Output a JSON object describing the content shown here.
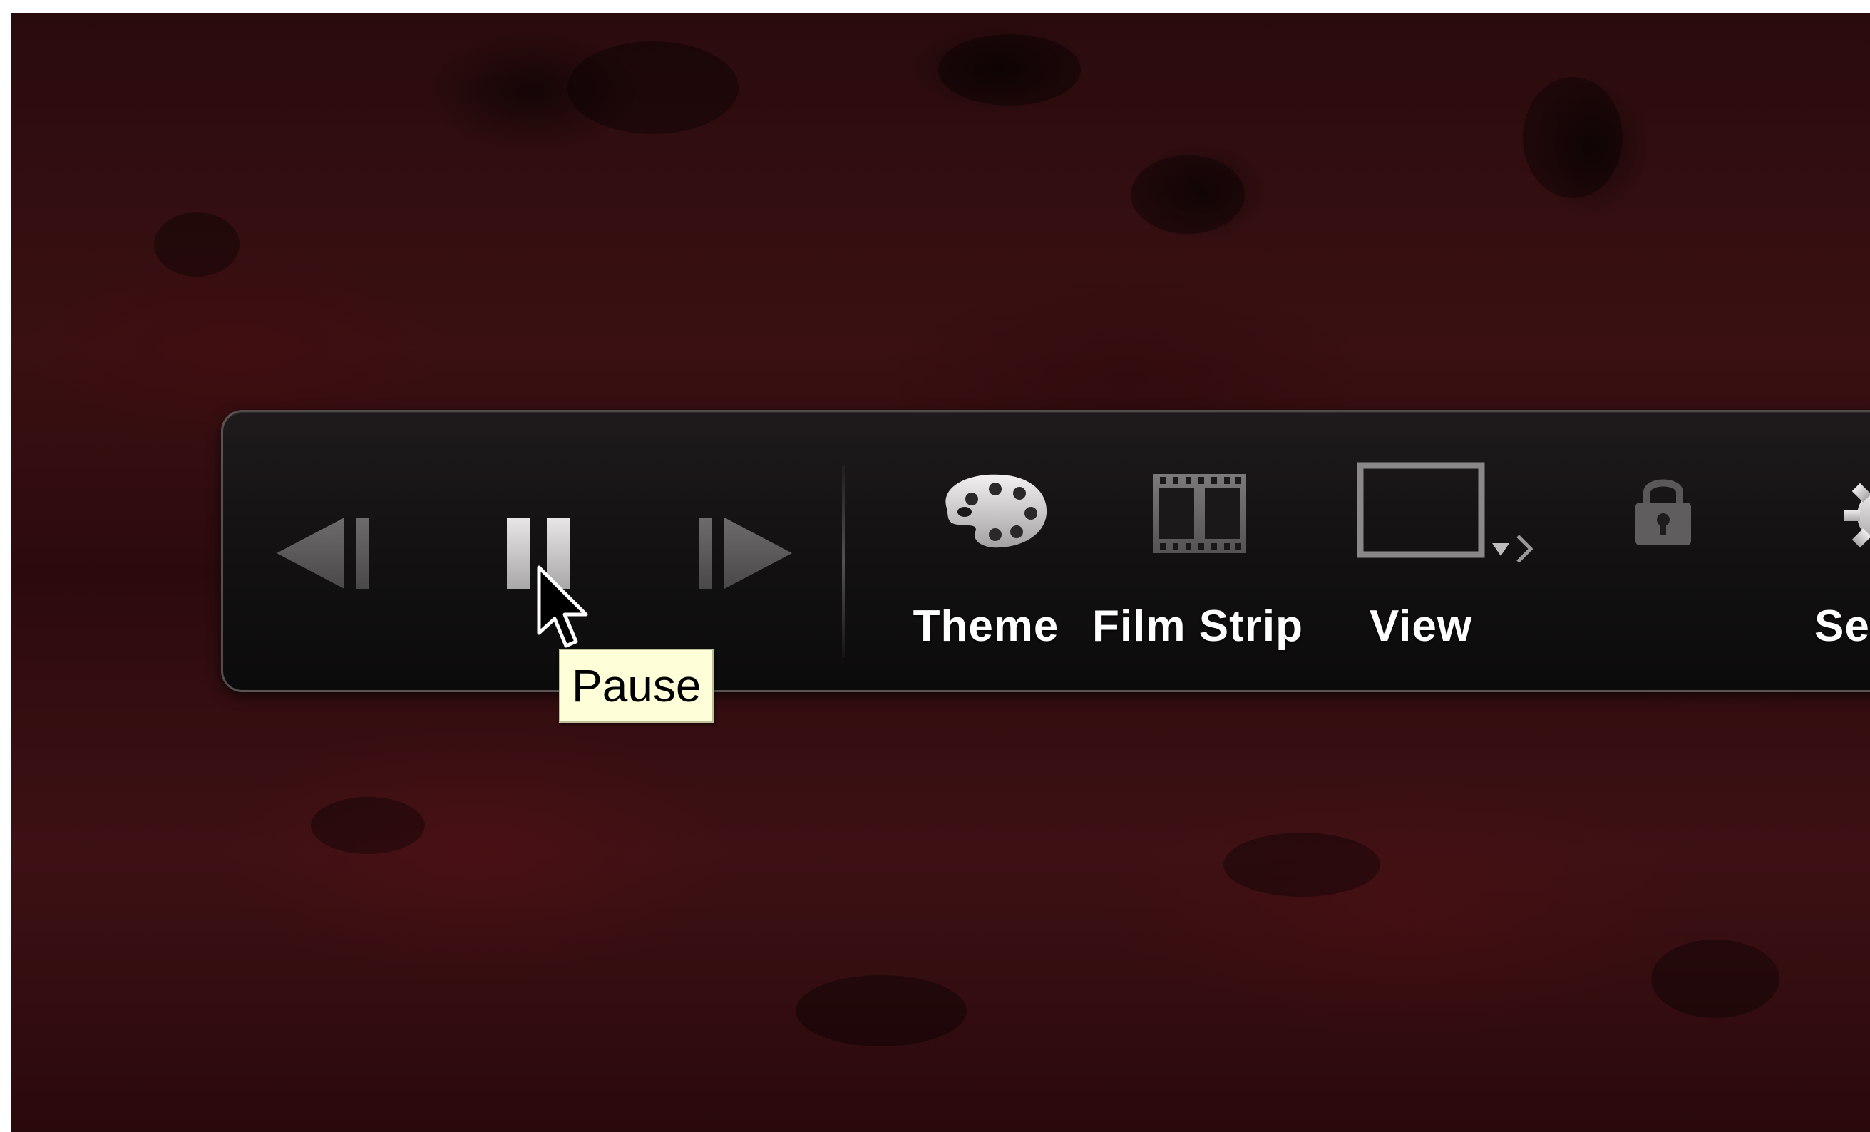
{
  "toolbar": {
    "previous": {
      "label": "",
      "icon": "previous-icon"
    },
    "pause": {
      "label": "",
      "icon": "pause-icon",
      "tooltip": "Pause"
    },
    "next": {
      "label": "",
      "icon": "next-icon"
    },
    "theme": {
      "label": "Theme",
      "icon": "palette-icon"
    },
    "film_strip": {
      "label": "Film Strip",
      "icon": "film-strip-icon"
    },
    "view": {
      "label": "View",
      "icon": "view-rectangle-icon"
    },
    "lock": {
      "label": "",
      "icon": "lock-icon"
    },
    "settings": {
      "label": "Set",
      "icon": "gear-icon"
    }
  },
  "colors": {
    "background": "#2f0c0e",
    "hud": "#141213",
    "label_text": "#ffffff",
    "tooltip_bg": "#fefed8"
  }
}
